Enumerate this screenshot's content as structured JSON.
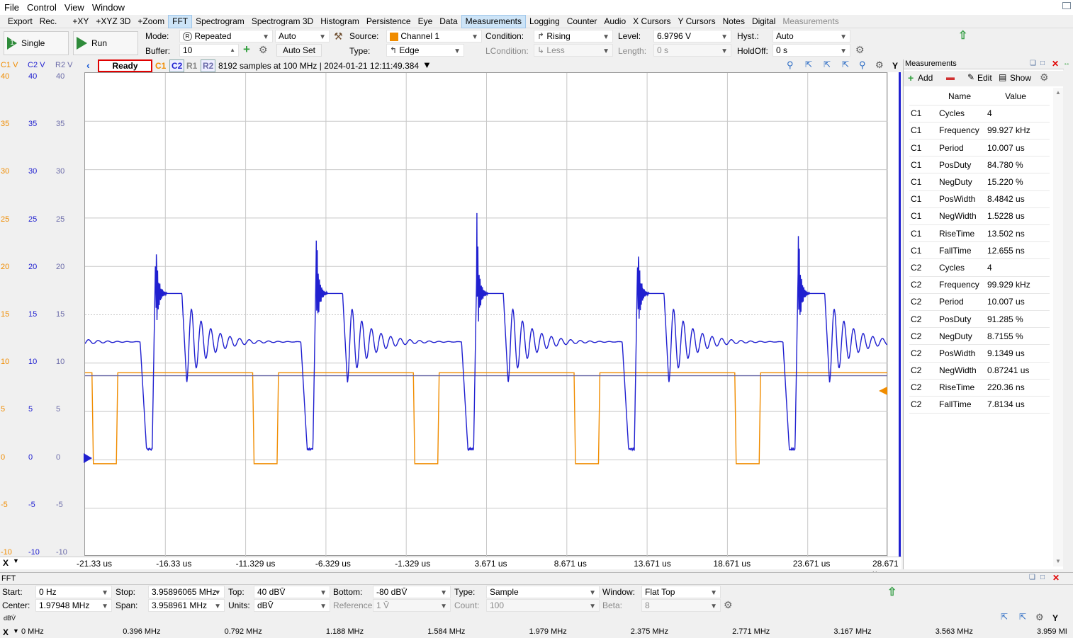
{
  "menu": [
    "File",
    "Control",
    "View",
    "Window"
  ],
  "tabs": [
    "Export",
    "Rec.",
    "+XY",
    "+XYZ 3D",
    "+Zoom",
    "FFT",
    "Spectrogram",
    "Spectrogram 3D",
    "Histogram",
    "Persistence",
    "Eye",
    "Data",
    "Measurements",
    "Logging",
    "Counter",
    "Audio",
    "X Cursors",
    "Y Cursors",
    "Notes",
    "Digital",
    "Measurements"
  ],
  "toolbar": {
    "single_label": "Single",
    "run_label": "Run",
    "mode_label": "Mode:",
    "mode_value": "Repeated",
    "mode_auto": "Auto",
    "buffer_label": "Buffer:",
    "buffer_value": "10",
    "autoset_label": "Auto Set",
    "source_label": "Source:",
    "source_value": "Channel 1",
    "type_label": "Type:",
    "type_value": "Edge",
    "condition_label": "Condition:",
    "condition_value": "Rising",
    "lcondition_label": "LCondition:",
    "lcondition_value": "Less",
    "level_label": "Level:",
    "level_value": "6.9796 V",
    "length_label": "Length:",
    "length_value": "0 s",
    "hyst_label": "Hyst.:",
    "hyst_value": "Auto",
    "holdoff_label": "HoldOff:",
    "holdoff_value": "0 s"
  },
  "status": {
    "c1v": "C1 V",
    "c2v": "C2 V",
    "r2v": "R2 V",
    "ready": "Ready",
    "c1": "C1",
    "c2": "C2",
    "r1": "R1",
    "r2": "R2",
    "info": "8192 samples at 100 MHz | 2024-01-21 12:11:49.384",
    "y_label": "Y"
  },
  "colors": {
    "c1": "#f08c00",
    "c2": "#2020d0",
    "r2": "#6a6aa8",
    "accent": "#cde4f7"
  },
  "yaxis": {
    "c1": [
      "40",
      "35",
      "30",
      "25",
      "20",
      "15",
      "10",
      "5",
      "0",
      "-5",
      "-10"
    ],
    "c2": [
      "40",
      "35",
      "30",
      "25",
      "20",
      "15",
      "10",
      "5",
      "0",
      "-5",
      "-10"
    ],
    "r2": [
      "40",
      "35",
      "30",
      "25",
      "20",
      "15",
      "10",
      "5",
      "0",
      "-5",
      "-10"
    ]
  },
  "xaxis": {
    "label": "X",
    "ticks": [
      "-21.33 us",
      "-16.33 us",
      "-11.329 us",
      "-6.329 us",
      "-1.329 us",
      "3.671 us",
      "8.671 us",
      "13.671 us",
      "18.671 us",
      "23.671 us",
      "28.671 u"
    ]
  },
  "measurements": {
    "title": "Measurements",
    "add_label": "Add",
    "edit_label": "Edit",
    "show_label": "Show",
    "col_name": "Name",
    "col_value": "Value",
    "rows": [
      [
        "C1",
        "Cycles",
        "4"
      ],
      [
        "C1",
        "Frequency",
        "99.927 kHz"
      ],
      [
        "C1",
        "Period",
        "10.007 us"
      ],
      [
        "C1",
        "PosDuty",
        "84.780 %"
      ],
      [
        "C1",
        "NegDuty",
        "15.220 %"
      ],
      [
        "C1",
        "PosWidth",
        "8.4842 us"
      ],
      [
        "C1",
        "NegWidth",
        "1.5228 us"
      ],
      [
        "C1",
        "RiseTime",
        "13.502 ns"
      ],
      [
        "C1",
        "FallTime",
        "12.655 ns"
      ],
      [
        "C2",
        "Cycles",
        "4"
      ],
      [
        "C2",
        "Frequency",
        "99.929 kHz"
      ],
      [
        "C2",
        "Period",
        "10.007 us"
      ],
      [
        "C2",
        "PosDuty",
        "91.285 %"
      ],
      [
        "C2",
        "NegDuty",
        "8.7155 %"
      ],
      [
        "C2",
        "PosWidth",
        "9.1349 us"
      ],
      [
        "C2",
        "NegWidth",
        "0.87241 us"
      ],
      [
        "C2",
        "RiseTime",
        "220.36 ns"
      ],
      [
        "C2",
        "FallTime",
        "7.8134 us"
      ]
    ]
  },
  "fft": {
    "title": "FFT",
    "start_label": "Start:",
    "start_value": "0 Hz",
    "stop_label": "Stop:",
    "stop_value": "3.95896065 MHz",
    "top_label": "Top:",
    "top_value": "40 dBV̄",
    "bottom_label": "Bottom:",
    "bottom_value": "-80 dBV̄",
    "type_label": "Type:",
    "type_value": "Sample",
    "window_label": "Window:",
    "window_value": "Flat Top",
    "center_label": "Center:",
    "center_value": "1.97948 MHz",
    "span_label": "Span:",
    "span_value": "3.958961 MHz",
    "units_label": "Units:",
    "units_value": "dBV̄",
    "reference_label": "Reference:",
    "reference_value": "1 V̄",
    "count_label": "Count:",
    "count_value": "100",
    "beta_label": "Beta:",
    "beta_value": "8",
    "db_label": "dBV̄",
    "y_label": "Y",
    "x_label": "X",
    "ticks": [
      "0 MHz",
      "0.396 MHz",
      "0.792 MHz",
      "1.188 MHz",
      "1.584 MHz",
      "1.979 MHz",
      "2.375 MHz",
      "2.771 MHz",
      "3.167 MHz",
      "3.563 MHz",
      "3.959 MI"
    ]
  }
}
